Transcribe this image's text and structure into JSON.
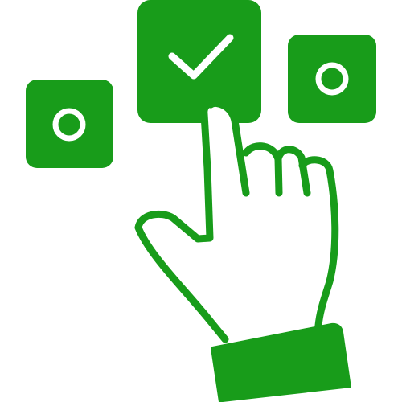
{
  "illustration": {
    "icon": "hand-pointer-choosing-option-icon",
    "accent_color": "#189c1a",
    "background_color": "#ffffff",
    "options": [
      {
        "icon": "option-unselected-icon",
        "state": "unselected"
      },
      {
        "icon": "checkmark-icon",
        "state": "selected"
      },
      {
        "icon": "option-unselected-icon",
        "state": "unselected"
      }
    ],
    "hand_icon": "pointing-hand-icon"
  }
}
